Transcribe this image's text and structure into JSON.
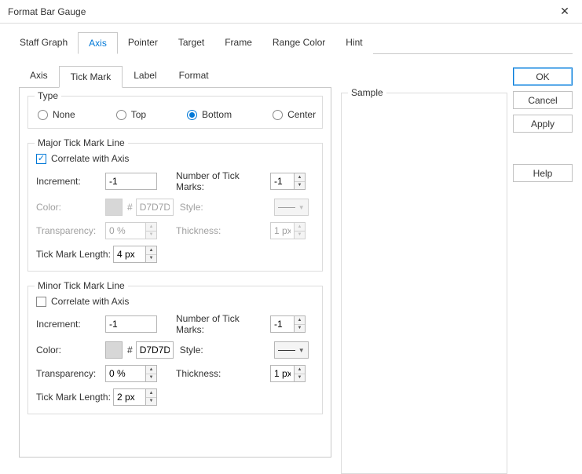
{
  "window": {
    "title": "Format Bar Gauge"
  },
  "tabs_top": [
    "Staff Graph",
    "Axis",
    "Pointer",
    "Target",
    "Frame",
    "Range Color",
    "Hint"
  ],
  "tabs_sub": [
    "Axis",
    "Tick Mark",
    "Label",
    "Format"
  ],
  "type_group": {
    "legend": "Type",
    "options": {
      "none": "None",
      "top": "Top",
      "bottom": "Bottom",
      "center": "Center"
    }
  },
  "major": {
    "legend": "Major Tick Mark Line",
    "correlate": "Correlate with Axis",
    "increment_lbl": "Increment:",
    "increment": "-1",
    "num_lbl": "Number of Tick Marks:",
    "num": "-1",
    "color_lbl": "Color:",
    "color_hex": "D7D7D7",
    "style_lbl": "Style:",
    "trans_lbl": "Transparency:",
    "trans": "0 %",
    "thick_lbl": "Thickness:",
    "thick": "1 px",
    "len_lbl": "Tick Mark Length:",
    "len": "4 px"
  },
  "minor": {
    "legend": "Minor Tick Mark Line",
    "correlate": "Correlate with Axis",
    "increment_lbl": "Increment:",
    "increment": "-1",
    "num_lbl": "Number of Tick Marks:",
    "num": "-1",
    "color_lbl": "Color:",
    "color_hex": "D7D7D7",
    "style_lbl": "Style:",
    "trans_lbl": "Transparency:",
    "trans": "0 %",
    "thick_lbl": "Thickness:",
    "thick": "1 px",
    "len_lbl": "Tick Mark Length:",
    "len": "2 px"
  },
  "sample_lbl": "Sample",
  "buttons": {
    "ok": "OK",
    "cancel": "Cancel",
    "apply": "Apply",
    "help": "Help"
  },
  "hash": "#"
}
